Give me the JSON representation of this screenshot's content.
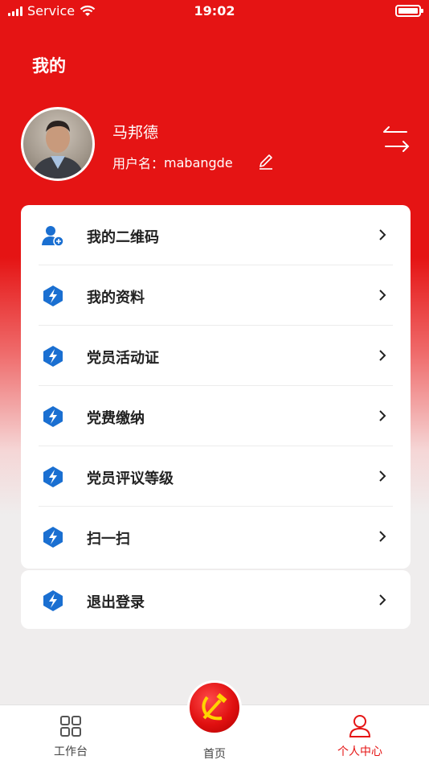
{
  "status_bar": {
    "carrier": "Service",
    "time": "19:02"
  },
  "header": {
    "title": "我的"
  },
  "profile": {
    "name": "马邦德",
    "username_label": "用户名：",
    "username": "mabangde"
  },
  "menu": {
    "items": [
      {
        "label": "我的二维码",
        "icon": "user-add-icon"
      },
      {
        "label": "我的资料",
        "icon": "lightning-shield-icon"
      },
      {
        "label": "党员活动证",
        "icon": "lightning-shield-icon"
      },
      {
        "label": "党费缴纳",
        "icon": "lightning-shield-icon"
      },
      {
        "label": "党员评议等级",
        "icon": "lightning-shield-icon"
      },
      {
        "label": "扫一扫",
        "icon": "lightning-shield-icon"
      }
    ],
    "logout": {
      "label": "退出登录",
      "icon": "lightning-shield-icon"
    }
  },
  "tabbar": {
    "workbench": "工作台",
    "home": "首页",
    "profile": "个人中心"
  },
  "colors": {
    "primary_red": "#e51414",
    "icon_blue": "#1a6fd1",
    "active_tab": "#e51414"
  }
}
